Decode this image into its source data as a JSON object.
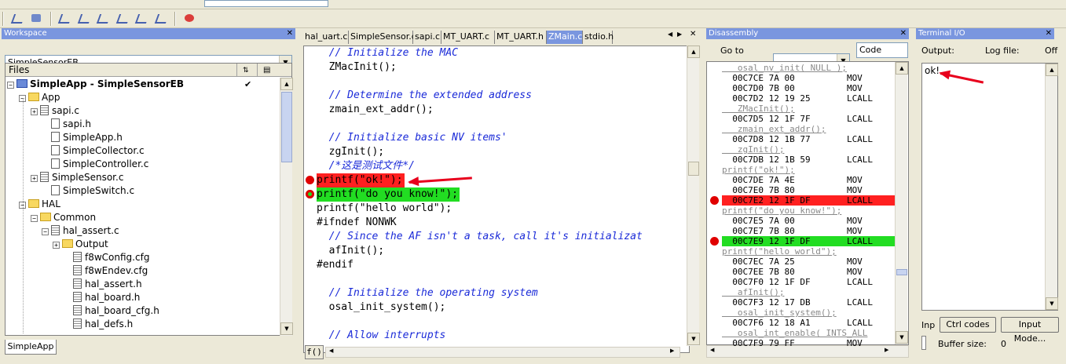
{
  "workspace": {
    "title": "Workspace",
    "config": "SimpleSensorEB",
    "files_header": "Files",
    "bottom_tab": "SimpleApp",
    "tree": [
      {
        "label": "SimpleApp - SimpleSensorEB",
        "check": "✔"
      },
      {
        "label": "App"
      },
      {
        "label": "sapi.c"
      },
      {
        "label": "sapi.h"
      },
      {
        "label": "SimpleApp.h"
      },
      {
        "label": "SimpleCollector.c"
      },
      {
        "label": "SimpleController.c"
      },
      {
        "label": "SimpleSensor.c"
      },
      {
        "label": "SimpleSwitch.c"
      },
      {
        "label": "HAL"
      },
      {
        "label": "Common"
      },
      {
        "label": "hal_assert.c"
      },
      {
        "label": "Output"
      },
      {
        "label": "f8wConfig.cfg"
      },
      {
        "label": "f8wEndev.cfg"
      },
      {
        "label": "hal_assert.h"
      },
      {
        "label": "hal_board.h"
      },
      {
        "label": "hal_board_cfg.h"
      },
      {
        "label": "hal_defs.h"
      }
    ]
  },
  "editor": {
    "tabs": [
      "hal_uart.c",
      "SimpleSensor.c",
      "sapi.c",
      "MT_UART.c",
      "MT_UART.h",
      "ZMain.c",
      "stdio.h"
    ],
    "active_tab": "ZMain.c",
    "func_combo": "f()",
    "lines": [
      {
        "text": "  // Initialize the MAC",
        "type": "comment"
      },
      {
        "text": "  ZMacInit();",
        "type": "code"
      },
      {
        "text": "",
        "type": "code"
      },
      {
        "text": "  // Determine the extended address",
        "type": "comment"
      },
      {
        "text": "  zmain_ext_addr();",
        "type": "code"
      },
      {
        "text": "",
        "type": "code"
      },
      {
        "text": "  // Initialize basic NV items'",
        "type": "comment"
      },
      {
        "text": "  zgInit();",
        "type": "code"
      },
      {
        "text": "  /*这是测试文件*/",
        "type": "comment"
      },
      {
        "text": "printf(\"ok!\");",
        "type": "bp-red"
      },
      {
        "text": "printf(\"do you know!\");",
        "type": "bp-green"
      },
      {
        "text": "printf(\"hello world\");",
        "type": "code"
      },
      {
        "text": "#ifndef NONWK",
        "type": "code"
      },
      {
        "text": "  // Since the AF isn't a task, call it's initializat",
        "type": "comment"
      },
      {
        "text": "  afInit();",
        "type": "code"
      },
      {
        "text": "#endif",
        "type": "code"
      },
      {
        "text": "",
        "type": "code"
      },
      {
        "text": "  // Initialize the operating system",
        "type": "comment"
      },
      {
        "text": "  osal_init_system();",
        "type": "code"
      },
      {
        "text": "",
        "type": "code"
      },
      {
        "text": "  // Allow interrupts",
        "type": "comment"
      }
    ]
  },
  "disassembly": {
    "title": "Disassembly",
    "goto_label": "Go to",
    "code_label": "Code",
    "lines": [
      {
        "text": "   osal_nv_init( NULL );",
        "type": "src"
      },
      {
        "text": "  00C7CE 7A 00          MOV",
        "type": "asm"
      },
      {
        "text": "  00C7D0 7B 00          MOV",
        "type": "asm"
      },
      {
        "text": "  00C7D2 12 19 25       LCALL",
        "type": "asm"
      },
      {
        "text": "   ZMacInit();",
        "type": "src"
      },
      {
        "text": "  00C7D5 12 1F 7F       LCALL",
        "type": "asm"
      },
      {
        "text": "   zmain_ext_addr();",
        "type": "src"
      },
      {
        "text": "  00C7D8 12 1B 77       LCALL",
        "type": "asm"
      },
      {
        "text": "   zgInit();",
        "type": "src"
      },
      {
        "text": "  00C7DB 12 1B 59       LCALL",
        "type": "asm"
      },
      {
        "text": "printf(\"ok!\");",
        "type": "src"
      },
      {
        "text": "  00C7DE 7A 4E          MOV",
        "type": "asm"
      },
      {
        "text": "  00C7E0 7B 80          MOV",
        "type": "asm"
      },
      {
        "text": "  00C7E2 12 1F DF       LCALL",
        "type": "red"
      },
      {
        "text": "printf(\"do you know!\");",
        "type": "src"
      },
      {
        "text": "  00C7E5 7A 00          MOV",
        "type": "asm"
      },
      {
        "text": "  00C7E7 7B 80          MOV",
        "type": "asm"
      },
      {
        "text": "  00C7E9 12 1F DF       LCALL",
        "type": "green"
      },
      {
        "text": "printf(\"hello world\");",
        "type": "src"
      },
      {
        "text": "  00C7EC 7A 25          MOV",
        "type": "asm"
      },
      {
        "text": "  00C7EE 7B 80          MOV",
        "type": "asm"
      },
      {
        "text": "  00C7F0 12 1F DF       LCALL",
        "type": "asm"
      },
      {
        "text": "   afInit();",
        "type": "src"
      },
      {
        "text": "  00C7F3 12 17 DB       LCALL",
        "type": "asm"
      },
      {
        "text": "   osal_init_system();",
        "type": "src"
      },
      {
        "text": "  00C7F6 12 18 A1       LCALL",
        "type": "asm"
      },
      {
        "text": "   osal_int_enable( INTS_ALL",
        "type": "src"
      },
      {
        "text": "  00C7F9 79 FF          MOV",
        "type": "asm"
      }
    ]
  },
  "terminal": {
    "title": "Terminal I/O",
    "output_label": "Output:",
    "logfile_label": "Log file:",
    "logfile_value": "Off",
    "output_text": "ok!",
    "input_label": "Inp",
    "ctrl_codes_btn": "Ctrl codes",
    "input_mode_btn": "Input Mode...",
    "buffer_label": "Buffer size:",
    "buffer_value": "0"
  },
  "colors": {
    "breakpoint_red": "#ff2020",
    "current_green": "#22dd22",
    "title_blue": "#7a96df",
    "comment_blue": "#1a2ad8",
    "annotation_arrow": "#e8001c"
  }
}
